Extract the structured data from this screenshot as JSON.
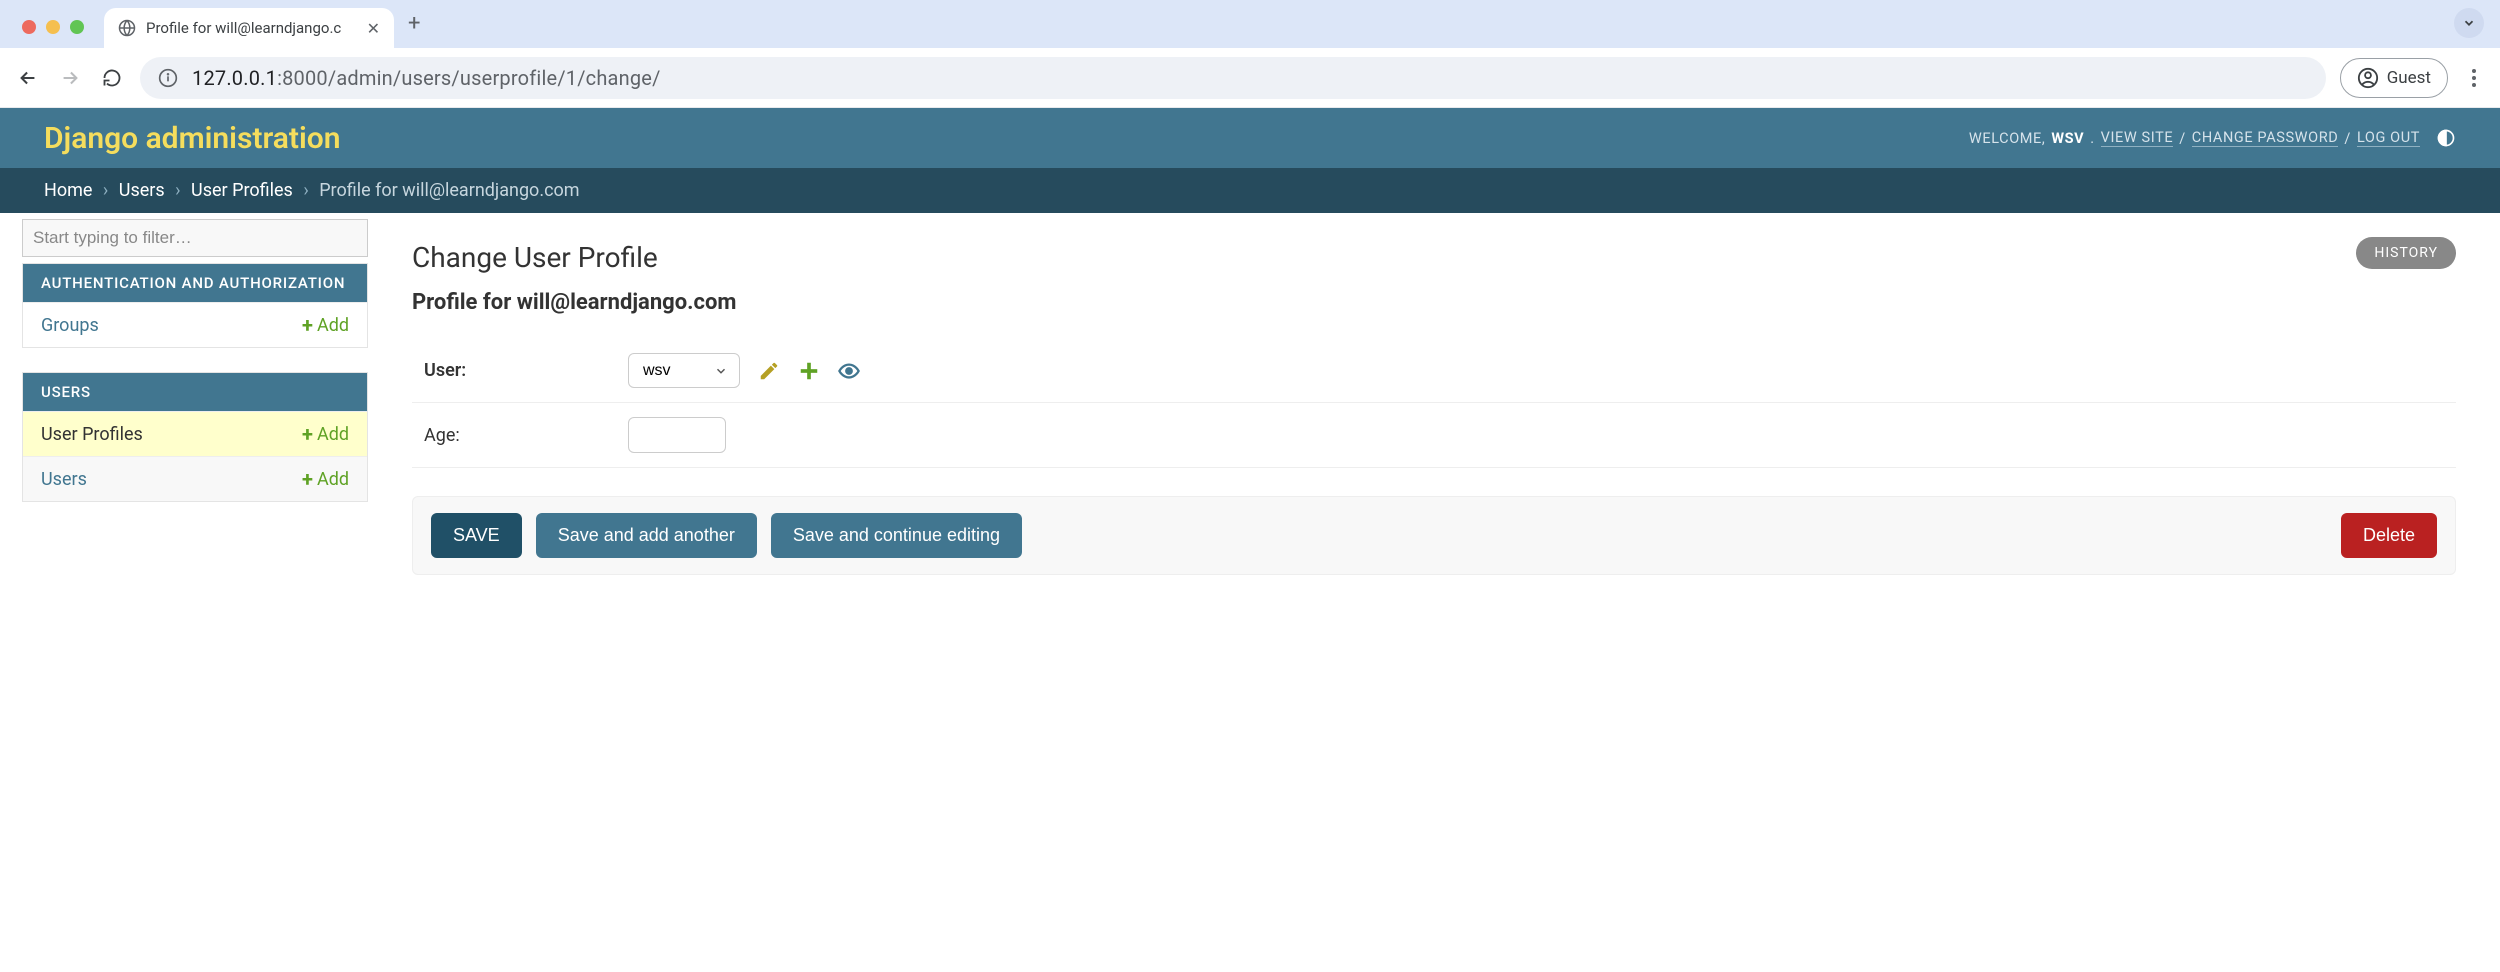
{
  "browser": {
    "tab_title": "Profile for will@learndjango.c",
    "url_host": "127.0.0.1",
    "url_port": ":8000",
    "url_path": "/admin/users/userprofile/1/change/",
    "guest_label": "Guest"
  },
  "header": {
    "branding": "Django administration",
    "welcome": "WELCOME,",
    "username": "WSV",
    "view_site": "VIEW SITE",
    "change_password": "CHANGE PASSWORD",
    "log_out": "LOG OUT"
  },
  "breadcrumbs": {
    "home": "Home",
    "app": "Users",
    "model": "User Profiles",
    "object": "Profile for will@learndjango.com"
  },
  "sidebar": {
    "filter_placeholder": "Start typing to filter…",
    "modules": [
      {
        "caption": "AUTHENTICATION AND AUTHORIZATION",
        "rows": [
          {
            "label": "Groups",
            "add": "Add"
          }
        ]
      },
      {
        "caption": "USERS",
        "rows": [
          {
            "label": "User Profiles",
            "add": "Add"
          },
          {
            "label": "Users",
            "add": "Add"
          }
        ]
      }
    ]
  },
  "content": {
    "title": "Change User Profile",
    "history": "HISTORY",
    "object_repr": "Profile for will@learndjango.com",
    "user_label": "User:",
    "user_selected": "wsv",
    "age_label": "Age:",
    "age_value": "",
    "save": "SAVE",
    "save_add_another": "Save and add another",
    "save_continue": "Save and continue editing",
    "delete": "Delete"
  }
}
